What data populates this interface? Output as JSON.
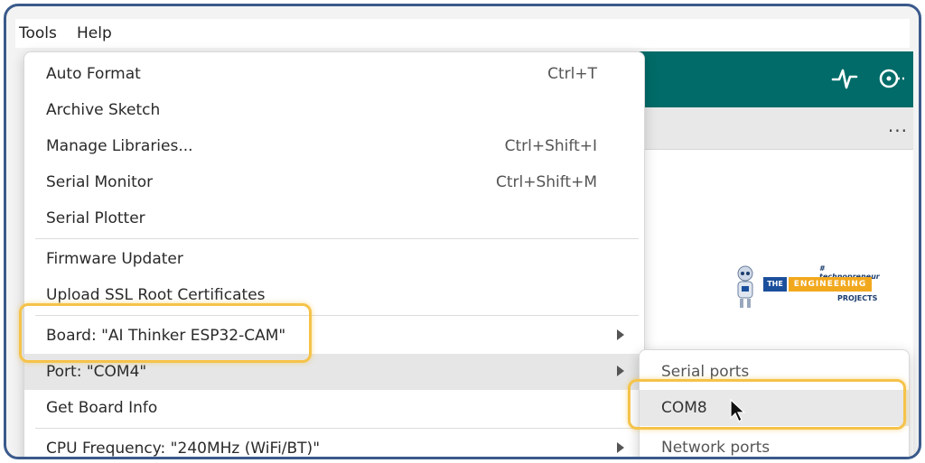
{
  "menubar": {
    "items": [
      "Tools",
      "Help"
    ]
  },
  "menu": {
    "items": [
      {
        "label": "Auto Format",
        "shortcut": "Ctrl+T"
      },
      {
        "label": "Archive Sketch",
        "shortcut": ""
      },
      {
        "label": "Manage Libraries...",
        "shortcut": "Ctrl+Shift+I"
      },
      {
        "label": "Serial Monitor",
        "shortcut": "Ctrl+Shift+M"
      },
      {
        "label": "Serial Plotter",
        "shortcut": ""
      },
      {
        "label": "Firmware Updater",
        "shortcut": ""
      },
      {
        "label": "Upload SSL Root Certificates",
        "shortcut": ""
      },
      {
        "label": "Board: \"AI Thinker ESP32-CAM\"",
        "shortcut": "",
        "submenu": true
      },
      {
        "label": "Port: \"COM4\"",
        "shortcut": "",
        "submenu": true,
        "active": true
      },
      {
        "label": "Get Board Info",
        "shortcut": ""
      },
      {
        "label": "CPU Frequency: \"240MHz (WiFi/BT)\"",
        "shortcut": "",
        "submenu": true
      }
    ]
  },
  "submenu": {
    "items": [
      {
        "label": "Serial ports",
        "type": "header"
      },
      {
        "label": "COM8",
        "type": "item",
        "highlighted": true
      },
      {
        "label": "Network ports",
        "type": "header"
      }
    ]
  },
  "ide": {
    "header_color": "#006b68",
    "header_icons": [
      "serial-plotter-icon",
      "serial-monitor-icon"
    ],
    "more_label": "..."
  },
  "logo": {
    "tagline": "# technopreneur",
    "the": "THE",
    "engineering": "ENGINEERING",
    "projects": "PROJECTS"
  },
  "colors": {
    "highlight": "#f5c34a",
    "frame": "#3a5a8c",
    "menu_active": "#e6e6e6"
  }
}
